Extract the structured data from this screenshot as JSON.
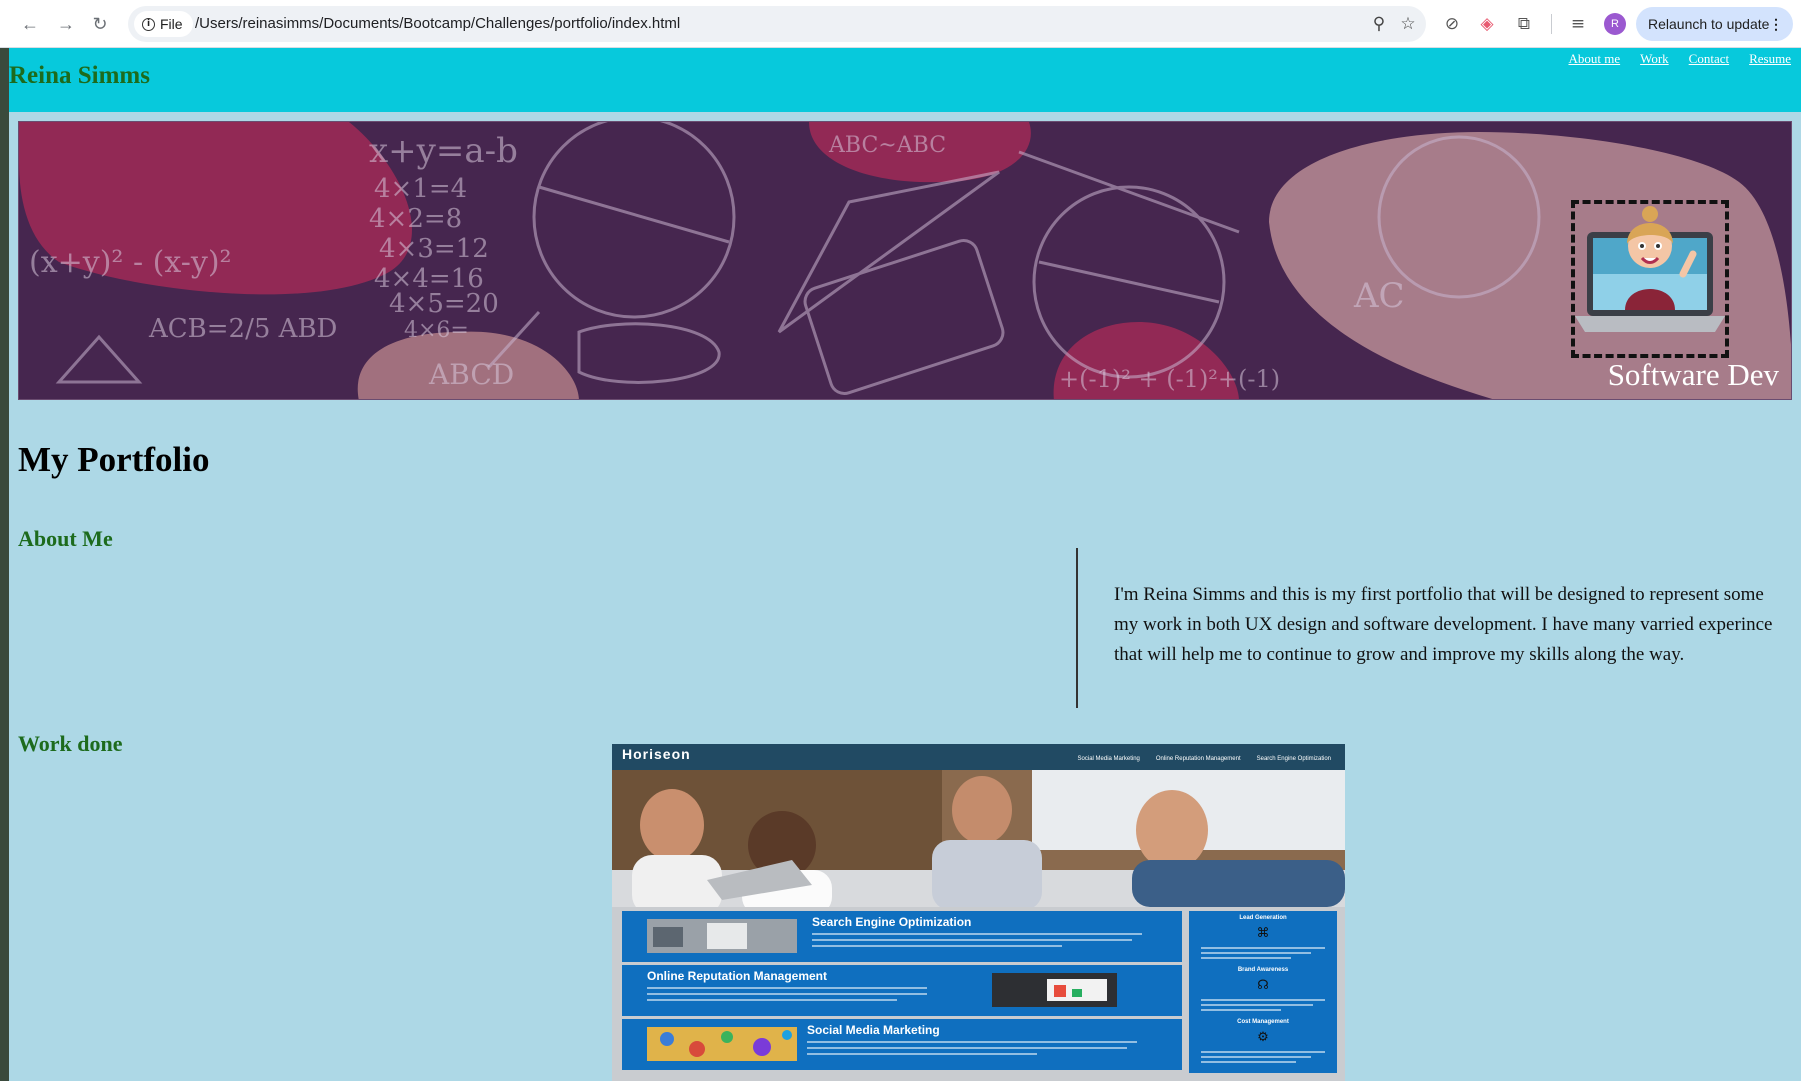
{
  "browser": {
    "file_chip_label": "File",
    "url": "/Users/reinasimms/Documents/Bootcamp/Challenges/portfolio/index.html",
    "profile_initial": "R",
    "relaunch_label": "Relaunch to update",
    "relaunch_menu": "⋮",
    "icons": {
      "back": "back-arrow-icon",
      "forward": "forward-arrow-icon",
      "reload": "reload-icon",
      "zoom": "zoom-icon",
      "bookmark": "star-icon",
      "extensions": "puzzle-icon"
    }
  },
  "site": {
    "name": "Reina Simms",
    "nav": [
      "About me",
      "Work",
      "Contact",
      "Resume"
    ],
    "hero_caption": "Software Dev",
    "page_title": "My Portfolio",
    "about": {
      "heading": "About Me",
      "lines": [
        "I'm Reina Simms and this is my first portfolio that will be designed to represent some",
        "my work in both UX design and software development. I have many varried experince",
        "that will help me to continue to grow and improve my skills along the way."
      ]
    },
    "work": {
      "heading": "Work done",
      "project": {
        "logo": "Horiseon",
        "nav": [
          "Social Media Marketing",
          "Online Reputation Management",
          "Search Engine Optimization"
        ],
        "cards": [
          "Search Engine Optimization",
          "Online Reputation Management",
          "Social Media Marketing"
        ],
        "side": [
          "Lead Generation",
          "Brand Awareness",
          "Cost Management"
        ]
      }
    }
  },
  "colors": {
    "header_bg": "#07c9dc",
    "page_bg": "#add8e6",
    "heading_green": "#1d6b1d",
    "hero_bg": "#46264f",
    "card_blue": "#0f6fbf"
  }
}
